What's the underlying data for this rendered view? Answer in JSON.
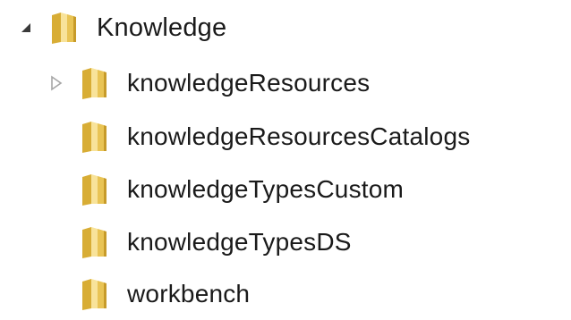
{
  "tree": {
    "root": {
      "label": "Knowledge",
      "expanded": true,
      "icon": "folder-icon",
      "toggle_icon": "triangle-expanded-icon"
    },
    "children": [
      {
        "label": "knowledgeResources",
        "has_children": true,
        "icon": "folder-icon",
        "toggle_icon": "triangle-collapsed-icon"
      },
      {
        "label": "knowledgeResourcesCatalogs",
        "has_children": false,
        "icon": "folder-icon"
      },
      {
        "label": "knowledgeTypesCustom",
        "has_children": false,
        "icon": "folder-icon"
      },
      {
        "label": "knowledgeTypesDS",
        "has_children": false,
        "icon": "folder-icon"
      },
      {
        "label": "workbench",
        "has_children": false,
        "icon": "folder-icon"
      }
    ]
  },
  "colors": {
    "folder_body": "#e9c455",
    "folder_shade": "#d8ad35",
    "folder_light": "#f8e39a",
    "folder_edge": "#c79b2a",
    "toggle_expanded": "#3a3a3a",
    "toggle_collapsed": "#a6a6a6",
    "text": "#1a1a1a"
  }
}
